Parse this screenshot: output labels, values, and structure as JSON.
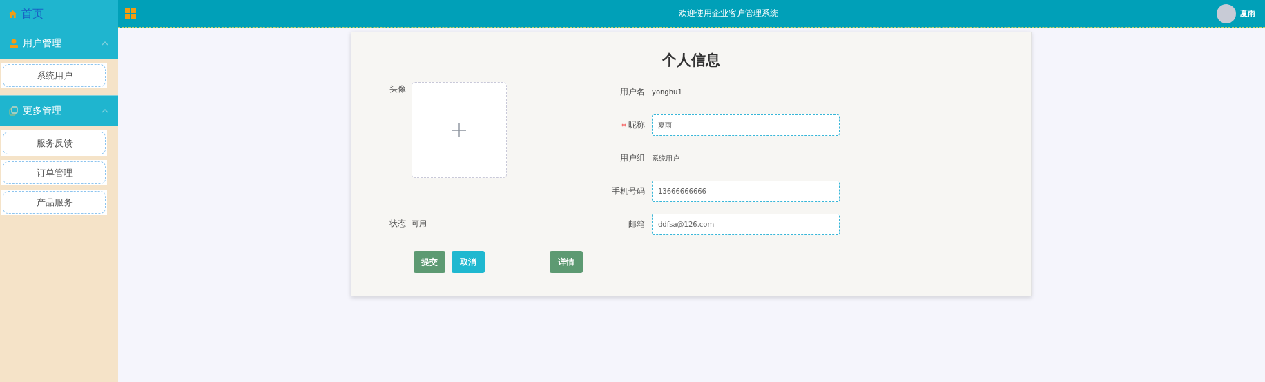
{
  "sidebar": {
    "home": {
      "label": "首页"
    },
    "groups": [
      {
        "title": "用户管理",
        "expanded": true,
        "items": [
          {
            "label": "系统用户"
          }
        ]
      },
      {
        "title": "更多管理",
        "expanded": true,
        "items": [
          {
            "label": "服务反馈"
          },
          {
            "label": "订单管理"
          },
          {
            "label": "产品服务"
          }
        ]
      }
    ]
  },
  "header": {
    "title": "欢迎使用企业客户管理系统",
    "user": "夏雨"
  },
  "form": {
    "title": "个人信息",
    "avatar": {
      "label": "头像"
    },
    "status": {
      "label": "状态",
      "value": "可用"
    },
    "fields": [
      {
        "kind": "text",
        "label": "用户名",
        "value": "yonghu1",
        "required": false
      },
      {
        "kind": "input",
        "label": "昵称",
        "value": "夏雨",
        "required": true
      },
      {
        "kind": "text",
        "label": "用户组",
        "value": "系统用户",
        "required": false
      },
      {
        "kind": "input",
        "label": "手机号码",
        "value": "13666666666",
        "required": false
      },
      {
        "kind": "input",
        "label": "邮箱",
        "value": "ddfsa@126.com",
        "required": false
      }
    ],
    "buttons": [
      {
        "label": "提交",
        "kind": "primary"
      },
      {
        "label": "取消",
        "kind": "secondary"
      }
    ],
    "detail_button": {
      "label": "详情"
    }
  }
}
